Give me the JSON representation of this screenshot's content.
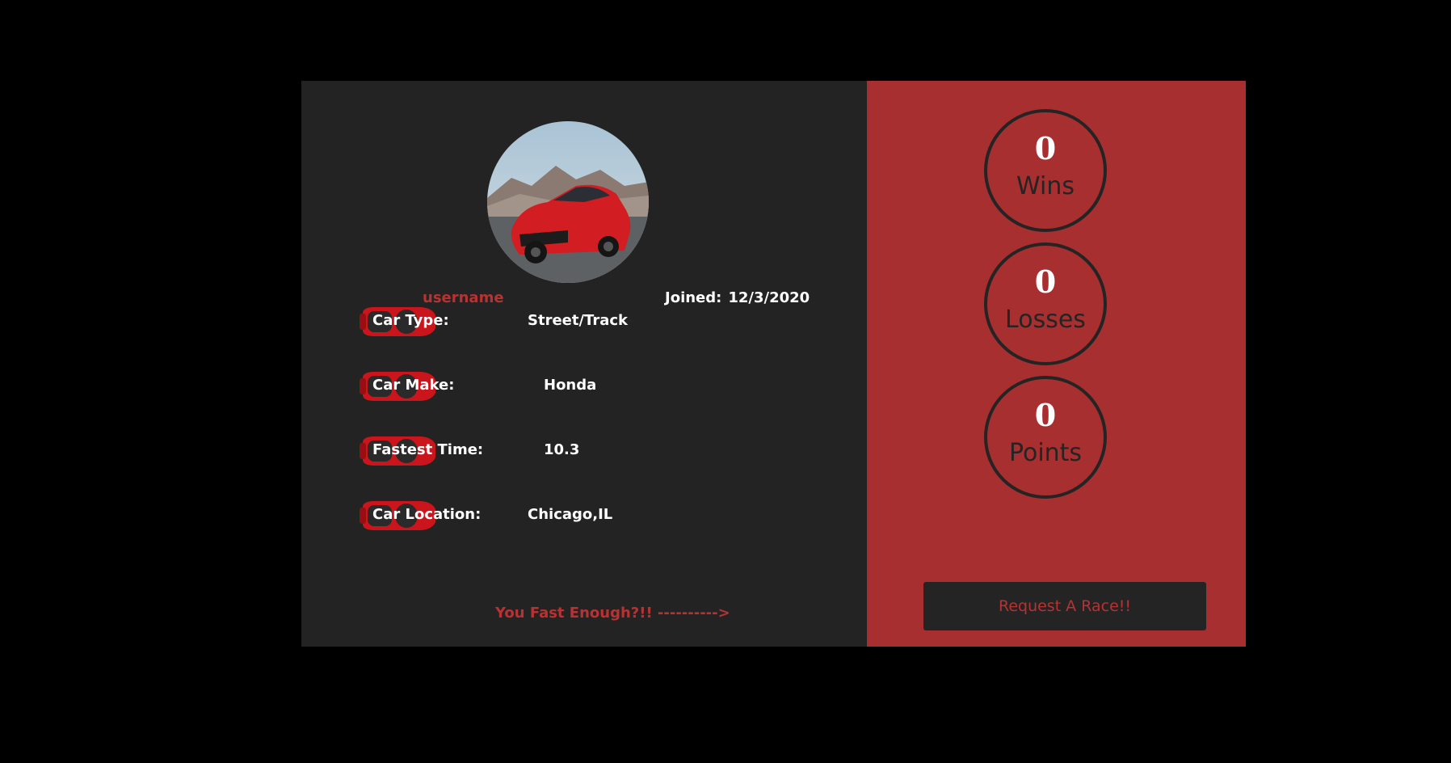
{
  "profile": {
    "username": "username",
    "joined_label": "Joined:",
    "joined_date": "12/3/2020",
    "avatar_icon": "red-sports-car-photo"
  },
  "details": [
    {
      "label": "Car Type:",
      "value": "Street/Track",
      "icon": "red-car-topview-icon"
    },
    {
      "label": "Car Make:",
      "value": "Honda",
      "icon": "red-car-topview-icon"
    },
    {
      "label": "Fastest Time:",
      "value": "10.3",
      "icon": "red-car-topview-icon"
    },
    {
      "label": "Car Location:",
      "value": "Chicago,IL",
      "icon": "red-car-topview-icon"
    }
  ],
  "tagline": "You Fast Enough?!! ---------->",
  "stats": {
    "wins": {
      "value": "0",
      "label": "Wins"
    },
    "losses": {
      "value": "0",
      "label": "Losses"
    },
    "points": {
      "value": "0",
      "label": "Points"
    }
  },
  "actions": {
    "request_race_label": "Request A Race!!"
  },
  "colors": {
    "page_bg": "#000000",
    "panel_dark": "#232323",
    "panel_red": "#a82f2f",
    "accent_red": "#b83232",
    "text_white": "#ffffff"
  }
}
